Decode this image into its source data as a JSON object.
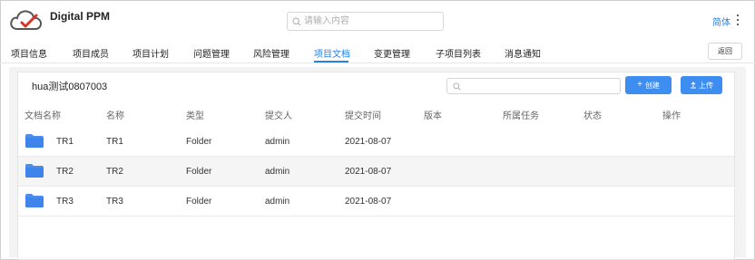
{
  "header": {
    "app_title": "Digital PPM",
    "search_placeholder": "请输入内容",
    "language": "简体"
  },
  "tabs": [
    {
      "label": "项目信息"
    },
    {
      "label": "项目成员"
    },
    {
      "label": "项目计划"
    },
    {
      "label": "问题管理"
    },
    {
      "label": "风险管理"
    },
    {
      "label": "项目文档",
      "active": true
    },
    {
      "label": "变更管理"
    },
    {
      "label": "子项目列表"
    },
    {
      "label": "消息通知"
    }
  ],
  "back_button": "返回",
  "folder": {
    "title": "hua测试0807003",
    "search_placeholder": "",
    "create_label": "创建",
    "upload_label": "上传"
  },
  "table": {
    "columns": [
      "文档名称",
      "名称",
      "类型",
      "提交人",
      "提交时间",
      "版本",
      "所属任务",
      "状态",
      "操作"
    ],
    "rows": [
      {
        "doc_name": "TR1",
        "name": "TR1",
        "type": "Folder",
        "submitter": "admin",
        "time": "2021-08-07",
        "version": "",
        "task": "",
        "status": "",
        "action": ""
      },
      {
        "doc_name": "TR2",
        "name": "TR2",
        "type": "Folder",
        "submitter": "admin",
        "time": "2021-08-07",
        "version": "",
        "task": "",
        "status": "",
        "action": ""
      },
      {
        "doc_name": "TR3",
        "name": "TR3",
        "type": "Folder",
        "submitter": "admin",
        "time": "2021-08-07",
        "version": "",
        "task": "",
        "status": "",
        "action": ""
      }
    ]
  },
  "icons": {
    "logo": "cloud-logo-icon",
    "search": "search-icon",
    "more": "more-vertical-icon",
    "folder": "folder-icon",
    "plus": "plus-icon",
    "upload": "upload-icon"
  },
  "colors": {
    "accent": "#2f7fe0",
    "button": "#3d8ef0",
    "folder": "#4a8ef0",
    "logo_red": "#d9342b"
  }
}
